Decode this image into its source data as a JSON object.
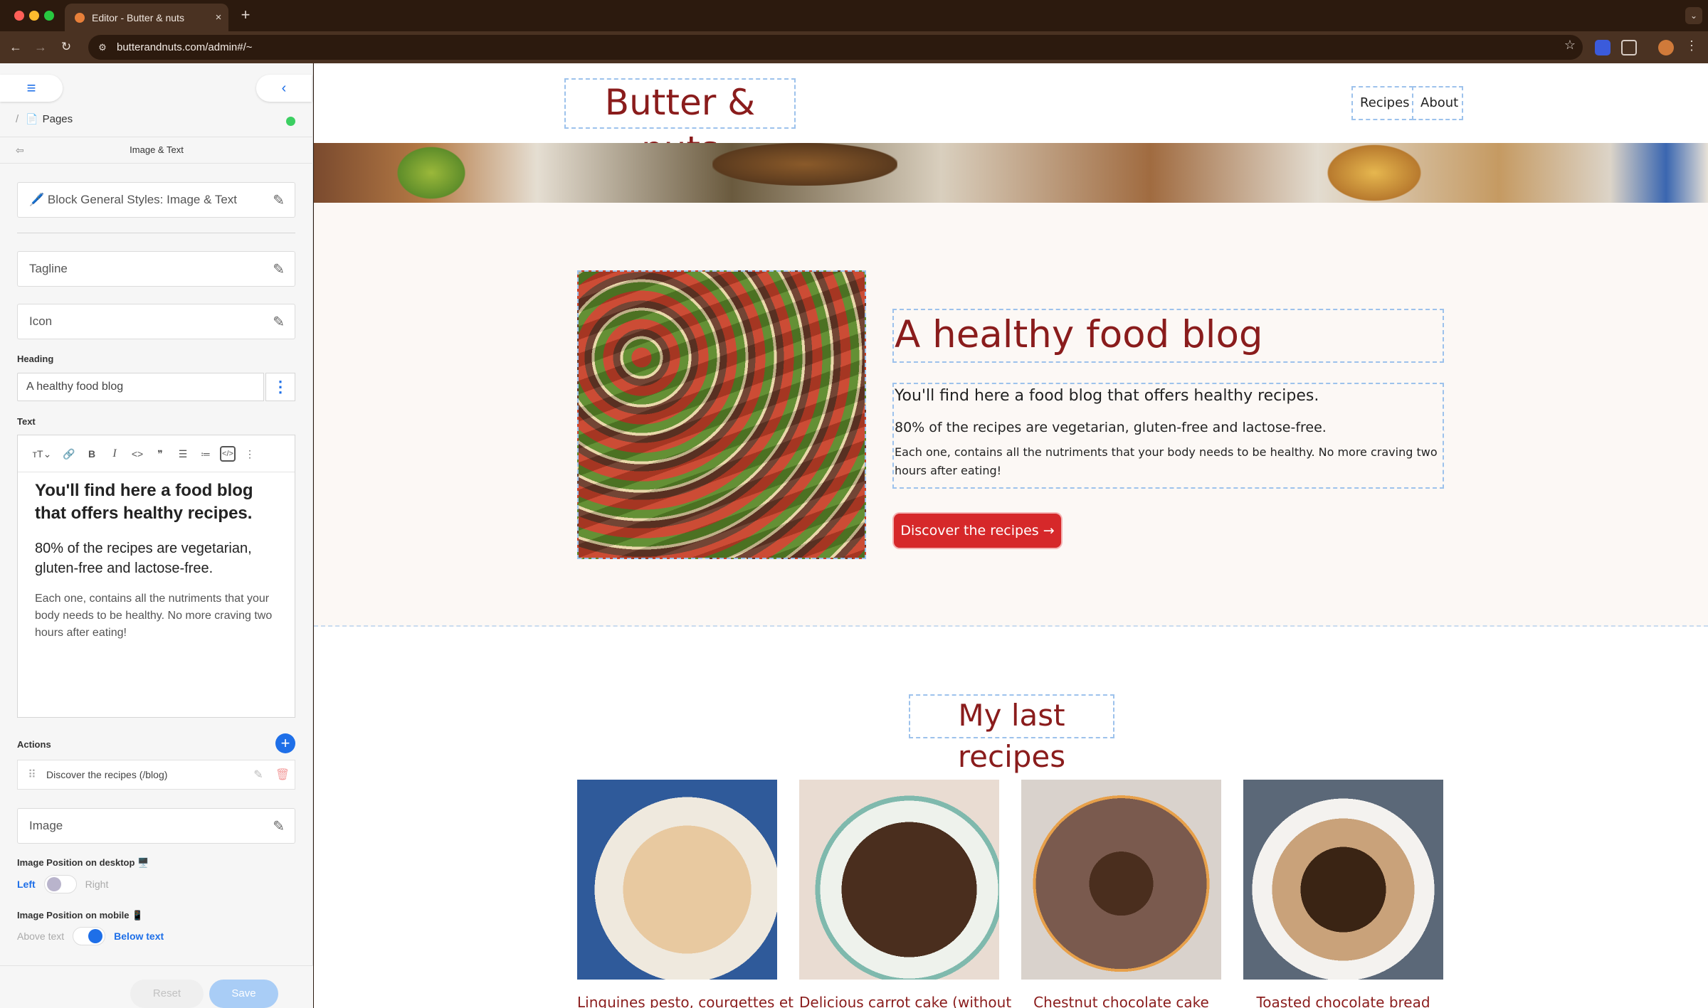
{
  "browser": {
    "tab_title": "Editor - Butter & nuts",
    "tab_close": "×",
    "new_tab": "+",
    "url": "butterandnuts.com/admin#/~",
    "icons": [
      "back-arrow-icon",
      "forward-arrow-icon",
      "reload-icon",
      "site-info-icon",
      "bookmark-star-icon",
      "extension-icon",
      "puzzle-icon",
      "profile-avatar",
      "kebab-menu-icon"
    ]
  },
  "sidebar": {
    "breadcrumb_sep": "/",
    "breadcrumb_label": "Pages",
    "panel_title": "Image & Text",
    "general_styles": "🖊️ Block General Styles: Image & Text",
    "tagline": "Tagline",
    "icon": "Icon",
    "heading_label": "Heading",
    "heading_value": "A healthy food blog",
    "text_label": "Text",
    "text_p1": "You'll find here a food blog that offers healthy recipes.",
    "text_p2": "80% of the recipes are vegetarian, gluten-free and lactose-free.",
    "text_p3": "Each one, contains all the nutriments that your body needs to be healthy. No more craving two hours after eating!",
    "actions_label": "Actions",
    "action_item": "Discover the recipes (/blog)",
    "image": "Image",
    "desktop_label": "Image Position on desktop 🖥️",
    "desktop_left": "Left",
    "desktop_right": "Right",
    "mobile_label": "Image Position on mobile 📱",
    "mobile_above": "Above text",
    "mobile_below": "Below text",
    "reset": "Reset",
    "save": "Save"
  },
  "site": {
    "title": "Butter & nuts",
    "nav": [
      "Recipes",
      "About"
    ],
    "hero": {
      "heading": "A healthy food blog",
      "p1": "You'll find here a food blog that offers healthy recipes.",
      "p2": "80% of the recipes are vegetarian, gluten-free and lactose-free.",
      "p3": "Each one, contains all the nutriments that your body needs to be healthy. No more craving two hours after eating!",
      "cta": "Discover the recipes →"
    },
    "recipes_heading": "My last recipes",
    "recipes": [
      {
        "title": "Linguines pesto, courgettes et"
      },
      {
        "title": "Delicious carrot cake (without"
      },
      {
        "title": "Chestnut chocolate cake"
      },
      {
        "title": "Toasted chocolate bread"
      }
    ]
  },
  "colors": {
    "brand": "#8a1c1c",
    "cta": "#d6282a",
    "accent": "#1e6fe8"
  }
}
